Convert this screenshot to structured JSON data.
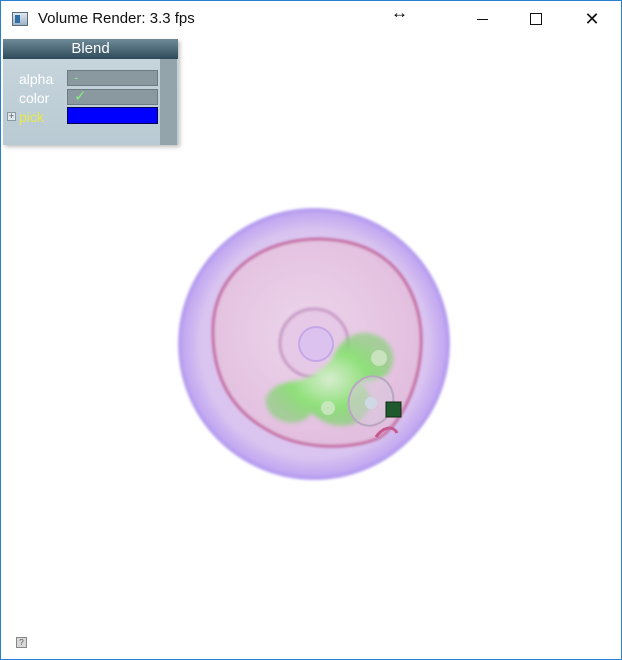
{
  "window": {
    "title": "Volume Render: 3.3 fps",
    "resize_cursor": "↔",
    "close_glyph": "✕"
  },
  "panel": {
    "title": "Blend",
    "rows": [
      {
        "label": "alpha",
        "value": "-"
      },
      {
        "label": "color",
        "value": "✓"
      },
      {
        "label": "pick",
        "value": ""
      }
    ],
    "pick_color": "#0000ff"
  },
  "render": {
    "view": "volume rendered cell, green highlighted region, pick marker"
  },
  "colors": {
    "window_border": "#2b7fd0",
    "panel_header": "#2e4a59",
    "check": "#7ff07f",
    "pick_label": "#e8e84a"
  }
}
